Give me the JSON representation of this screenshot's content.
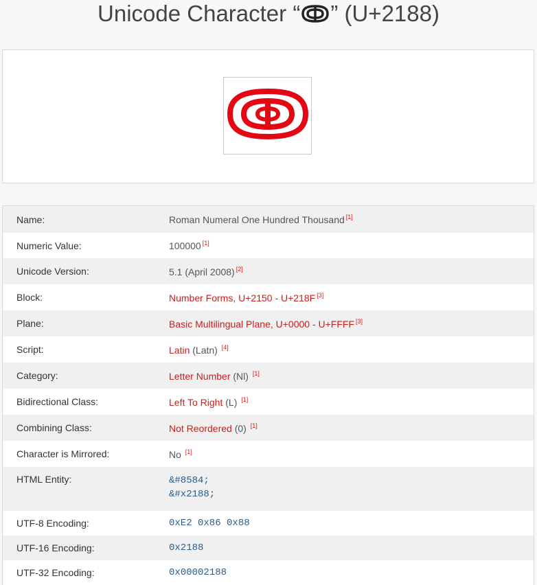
{
  "title": {
    "prefix": "Unicode Character “",
    "suffix": "” (U+2188)",
    "glyph_icon": "roman-numeral-hundred-thousand-glyph"
  },
  "preview": {
    "glyph_icon": "roman-numeral-hundred-thousand-glyph",
    "glyph_color": "#e30613"
  },
  "properties": {
    "name": {
      "label": "Name:",
      "value": "Roman Numeral One Hundred Thousand",
      "ref": "[1]"
    },
    "numeric": {
      "label": "Numeric Value:",
      "value": "100000",
      "ref": "[1]"
    },
    "version": {
      "label": "Unicode Version:",
      "value": "5.1 (April 2008)",
      "ref": "[2]"
    },
    "block": {
      "label": "Block:",
      "link": "Number Forms, U+2150 - U+218F",
      "ref": "[3]"
    },
    "plane": {
      "label": "Plane:",
      "link": "Basic Multilingual Plane, U+0000 - U+FFFF",
      "ref": "[3]"
    },
    "script": {
      "label": "Script:",
      "link": "Latin",
      "suffix": " (Latn) ",
      "ref": "[4]"
    },
    "category": {
      "label": "Category:",
      "link": "Letter Number",
      "suffix": " (Nl) ",
      "ref": "[1]"
    },
    "bidi": {
      "label": "Bidirectional Class:",
      "link": "Left To Right",
      "suffix": " (L) ",
      "ref": "[1]"
    },
    "combining": {
      "label": "Combining Class:",
      "link": "Not Reordered",
      "suffix": " (0) ",
      "ref": "[1]"
    },
    "mirrored": {
      "label": "Character is Mirrored:",
      "value": "No ",
      "ref": "[1]"
    },
    "html_entity": {
      "label": "HTML Entity:",
      "values": [
        "&#8584;",
        "&#x2188;"
      ]
    },
    "utf8": {
      "label": "UTF-8 Encoding:",
      "value": "0xE2 0x86 0x88"
    },
    "utf16": {
      "label": "UTF-16 Encoding:",
      "value": "0x2188"
    },
    "utf32": {
      "label": "UTF-32 Encoding:",
      "value": "0x00002188"
    }
  }
}
